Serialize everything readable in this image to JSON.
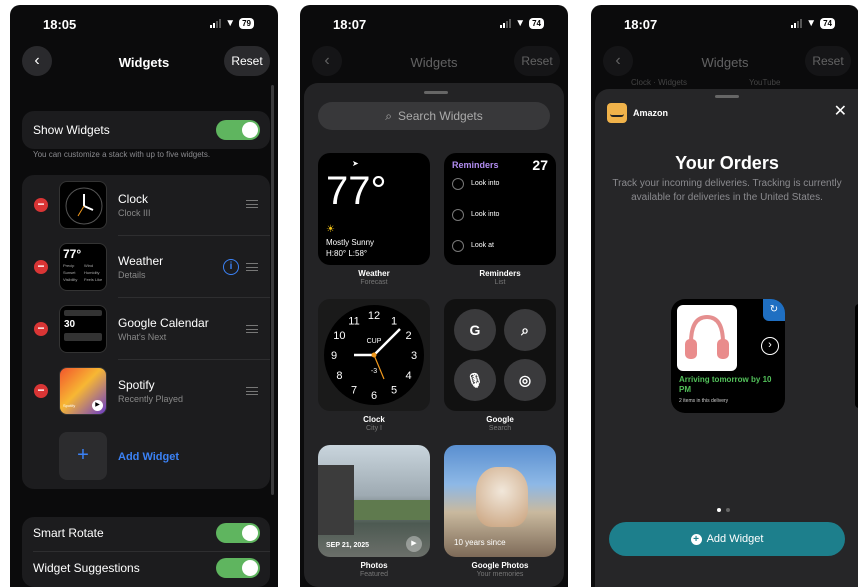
{
  "screen1": {
    "time": "18:05",
    "battery": "79",
    "title": "Widgets",
    "reset": "Reset",
    "show_widgets": "Show Widgets",
    "hint": "You can customize a stack with up to five widgets.",
    "widgets": [
      {
        "name": "Clock",
        "sub": "Clock III"
      },
      {
        "name": "Weather",
        "sub": "Details"
      },
      {
        "name": "Google Calendar",
        "sub": "What's Next"
      },
      {
        "name": "Spotify",
        "sub": "Recently Played"
      }
    ],
    "add_widget": "Add Widget",
    "smart_rotate": "Smart Rotate",
    "widget_suggestions": "Widget Suggestions",
    "weather_thumb": {
      "temp": "77°",
      "cells": [
        "Precip",
        "Wind",
        "Sunset",
        "Humidity",
        "Visibility",
        "Feels Like"
      ]
    },
    "calendar_thumb": {
      "day": "30"
    },
    "spotify_thumb": {
      "label": "Spotify"
    }
  },
  "screen2": {
    "time": "18:07",
    "battery": "74",
    "title": "Widgets",
    "reset": "Reset",
    "search_placeholder": "Search Widgets",
    "weather": {
      "temp": "77°",
      "cond": "Mostly Sunny",
      "hilo": "H:80° L:58°",
      "label": "Weather",
      "sub": "Forecast"
    },
    "reminders": {
      "header": "Reminders",
      "count": "27",
      "items": [
        "Look into",
        "Look into",
        "Look at"
      ],
      "label": "Reminders",
      "sub": "List"
    },
    "clock": {
      "label": "Clock",
      "sub": "City I",
      "city": "CUP",
      "offset": "-3",
      "numbers": [
        "12",
        "1",
        "2",
        "3",
        "4",
        "5",
        "6",
        "7",
        "8",
        "9",
        "10",
        "11"
      ]
    },
    "google": {
      "label": "Google",
      "sub": "Search",
      "g": "G"
    },
    "photos": {
      "date": "SEP 21, 2025",
      "label": "Photos",
      "sub": "Featured"
    },
    "gphotos": {
      "caption": "10 years since",
      "label": "Google Photos",
      "sub": "Your memories"
    }
  },
  "screen3": {
    "time": "18:07",
    "battery": "74",
    "title": "Widgets",
    "reset": "Reset",
    "behind_left": "Clock · Widgets",
    "behind_right": "YouTube",
    "app": "Amazon",
    "heading": "Your Orders",
    "desc": "Track your incoming deliveries. Tracking is currently available for deliveries in the United States.",
    "arriving": "Arriving tomorrow by 10 PM",
    "items": "2 items in this delivery",
    "add_widget": "Add Widget",
    "colors": {
      "teal": "#1d7f8c",
      "green": "#52c15a",
      "amazon": "#f0b24a"
    }
  }
}
